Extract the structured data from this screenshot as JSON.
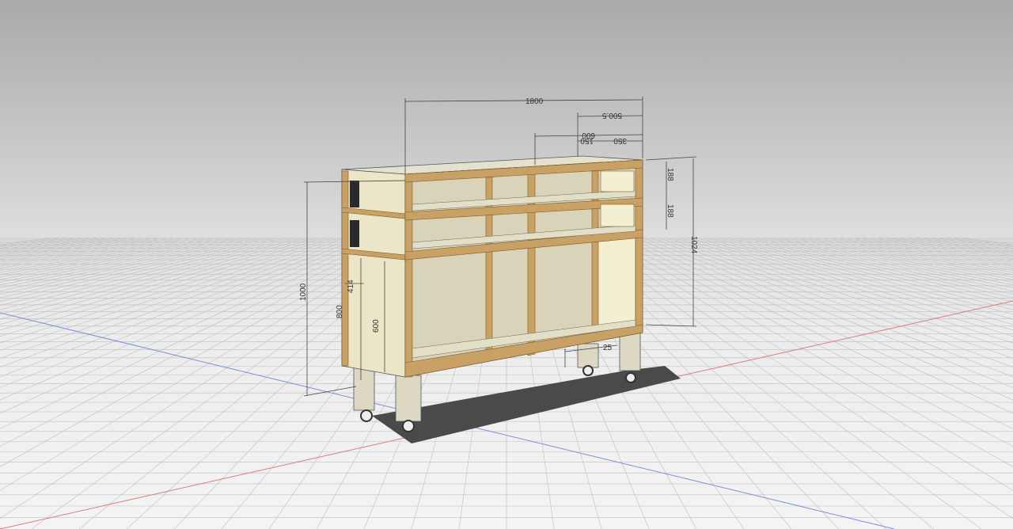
{
  "viewport": {
    "background_top": "#a9a9a9",
    "background_bottom": "#f4f4f4",
    "grid_color": "#bfbfbf",
    "x_axis_color": "#e07a7a",
    "y_axis_color": "#7a8fe0"
  },
  "model": {
    "frame_color": "#c9a165",
    "panel_color": "#ddd8bc",
    "leg_color": "#dcd8c4"
  },
  "dimensions": {
    "width_total": "1800",
    "width_part": "500.5",
    "depth_total": "600",
    "depth_a": "150",
    "depth_b": "350",
    "height_total": "1000",
    "height_side": "1024",
    "row_upper": "188",
    "row_lower": "188",
    "opening_height": "600",
    "side_height": "800",
    "small_offset": "414",
    "leg_label": "25"
  }
}
